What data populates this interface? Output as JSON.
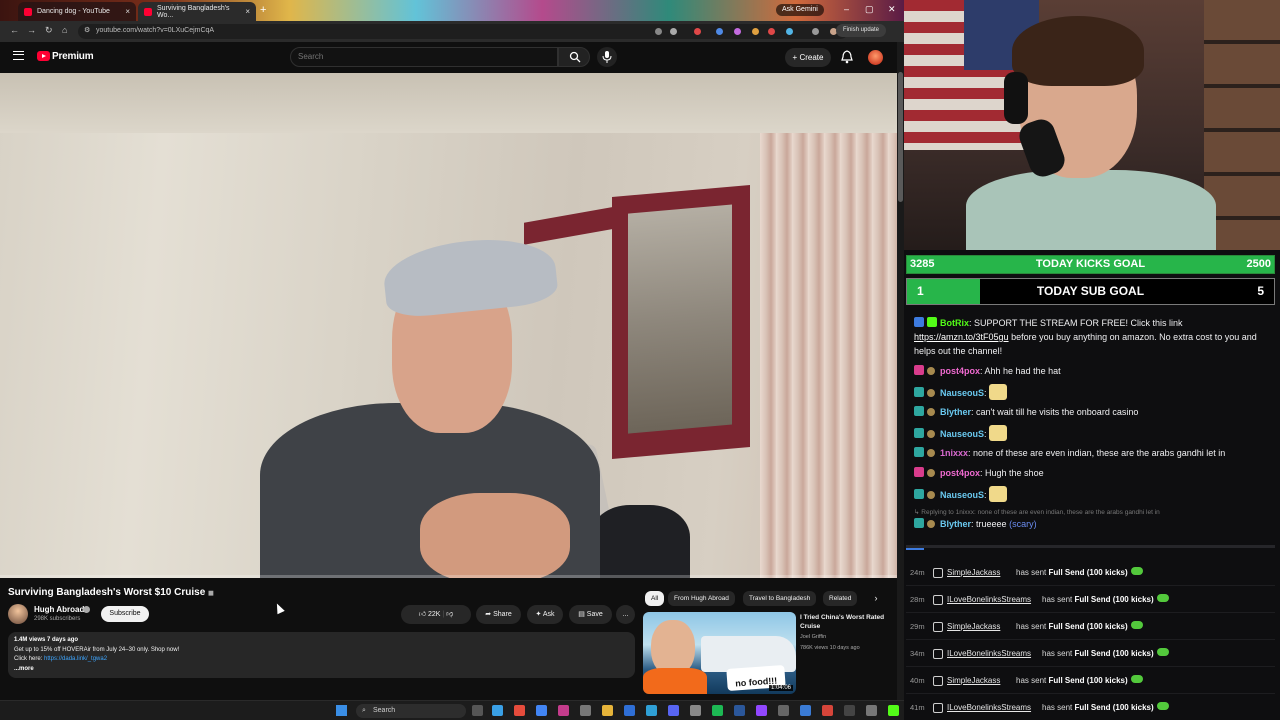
{
  "browser": {
    "tabs": [
      {
        "label": "Dancing dog - YouTube"
      },
      {
        "label": "Surviving Bangladesh's Wo..."
      }
    ],
    "new_tab": "+",
    "ask_gemini": "Ask Gemini",
    "url": "youtube.com/watch?v=0LXuCejmCqA",
    "finish_update": "Finish update"
  },
  "youtube": {
    "logo_text": "Premium",
    "search_placeholder": "Search",
    "create_label": "Create",
    "video": {
      "progress": 0.0,
      "title": "Surviving Bangladesh's Worst $10 Cruise",
      "channel": "Hugh Abroad",
      "subscribers": "298K subscribers",
      "subscribe_label": "Subscribe",
      "likes": "22K",
      "share_label": "Share",
      "ask_label": "Ask",
      "save_label": "Save",
      "more_label": "...",
      "stats": "1.4M views  7 days ago",
      "desc_line1": "Get up to 15% off HOVERAir from July 24–30 only. Shop now!",
      "desc_line2_prefix": "Click here: ",
      "desc_link": "https://dada.link/_tgwa2",
      "desc_more": "...more"
    },
    "chips": [
      "All",
      "From Hugh Abroad",
      "Travel to Bangladesh",
      "Related"
    ],
    "chip_next": "›",
    "related": {
      "title": "I Tried China's Worst Rated Cruise",
      "channel": "Joel Griffin",
      "meta": "786K views  10 days ago",
      "duration": "1:04:06",
      "sticker": "no food!!!"
    }
  },
  "taskbar": {
    "search_label": "Search"
  },
  "goals": {
    "kicks": {
      "current": "3285",
      "label": "TODAY KICKS GOAL",
      "target": "2500",
      "fill": 1.0
    },
    "subs": {
      "current": "1",
      "label": "TODAY SUB GOAL",
      "target": "5",
      "fill": 0.2
    }
  },
  "chat": {
    "messages": [
      {
        "user": "BotRix",
        "text": "SUPPORT THE STREAM FOR FREE! Click this link",
        "link": "https://amzn.to/3tF05gu",
        "text2": "before you buy anything on amazon. No extra cost to you and helps out the channel!"
      },
      {
        "user": "post4pox",
        "text": "Ahh he had the hat"
      },
      {
        "user": "NauseouS",
        "text": ""
      },
      {
        "user": "Blyther",
        "text": "can't wait till he visits the onboard casino"
      },
      {
        "user": "NauseouS",
        "text": ""
      },
      {
        "user": "1nixxx",
        "text": "none of these are even indian, these are the arabs gandhi let in"
      },
      {
        "user": "post4pox",
        "text": "Hugh the shoe"
      },
      {
        "user": "NauseouS",
        "text": ""
      },
      {
        "user": "Blyther",
        "text": "trueeee",
        "emote_text": "(scary)"
      }
    ],
    "reply_hint": "Replying to 1nixxx: none of these are even indian, these are the arabs gandhi let in"
  },
  "events": [
    {
      "age": "24m",
      "user": "SimpleJackass",
      "verb": "has sent",
      "item": "Full Send (100 kicks)"
    },
    {
      "age": "28m",
      "user": "ILoveBonelinksStreams",
      "verb": "has sent",
      "item": "Full Send (100 kicks)"
    },
    {
      "age": "29m",
      "user": "SimpleJackass",
      "verb": "has sent",
      "item": "Full Send (100 kicks)"
    },
    {
      "age": "34m",
      "user": "ILoveBonelinksStreams",
      "verb": "has sent",
      "item": "Full Send (100 kicks)"
    },
    {
      "age": "40m",
      "user": "SimpleJackass",
      "verb": "has sent",
      "item": "Full Send (100 kicks)"
    },
    {
      "age": "41m",
      "user": "ILoveBonelinksStreams",
      "verb": "has sent",
      "item": "Full Send (100 kicks)"
    }
  ]
}
